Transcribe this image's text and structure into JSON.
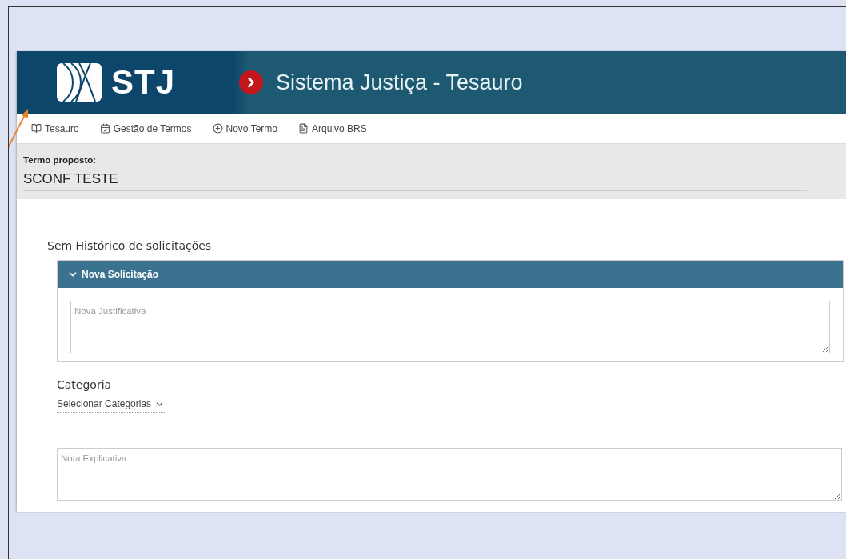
{
  "header": {
    "logo": "STJ",
    "title": "Sistema Justiça - Tesauro"
  },
  "nav": [
    {
      "label": "Tesauro",
      "kind": "book"
    },
    {
      "label": "Gestão de Termos",
      "kind": "calendar"
    },
    {
      "label": "Novo Termo",
      "kind": "plus"
    },
    {
      "label": "Arquivo BRS",
      "kind": "file"
    }
  ],
  "proposed_term": {
    "label": "Termo proposto:",
    "value": "SCONF TESTE"
  },
  "history_note": "Sem Histórico de solicitações",
  "request_panel": {
    "title": "Nova Solicitação",
    "expanded": true,
    "justification": {
      "placeholder": "Nova Justificativa"
    }
  },
  "category": {
    "label": "Categoria",
    "select": "Selecionar Categorias"
  },
  "note": {
    "placeholder": "Nota Explicativa"
  }
}
